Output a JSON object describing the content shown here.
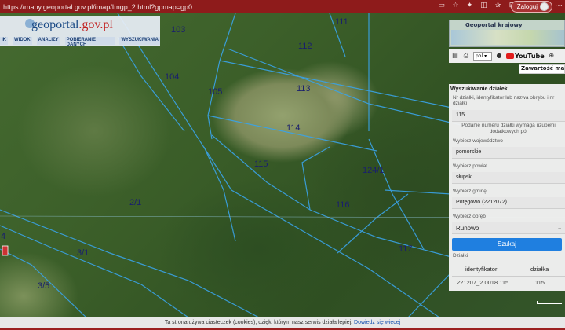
{
  "browser": {
    "url": "https://mapy.geoportal.gov.pl/imap/Imgp_2.html?gpmap=gp0",
    "login_label": "Zaloguj"
  },
  "logo": {
    "main": "geoportal",
    "suffix": ".gov.pl"
  },
  "topmenu": [
    "IK",
    "WIDOK",
    "ANALIZY",
    "POBIERANIE DANYCH",
    "WYSZUKIWANIA"
  ],
  "minimap": {
    "title": "Geoportal krajowy"
  },
  "toolbar": {
    "lang": "pol",
    "youtube": "YouTube",
    "contents_label": "Zawartość mapy"
  },
  "panel": {
    "title": "Wyszukiwanie działek",
    "parcel_label": "Nr działki, identyfikator lub nazwa obrębu i nr działki",
    "parcel_value": "115",
    "hint": "Podanie numeru działki wymaga uzupełni dodatkowych pól",
    "voiv_label": "Wybierz województwo",
    "voiv_value": "pomorskie",
    "county_label": "Wybierz powiat",
    "county_value": "słupski",
    "commune_label": "Wybierz gminę",
    "commune_value": "Potęgowo (2212072)",
    "precinct_label": "Wybierz obręb",
    "precinct_value": "Runowo",
    "search_button": "Szukaj",
    "results_label": "Działki",
    "table_headers": [
      "identyfikator",
      "działka"
    ],
    "table_rows": [
      [
        "221207_2.0018.115",
        "115"
      ]
    ]
  },
  "map": {
    "parcel_numbers": [
      "103",
      "111",
      "112",
      "104",
      "105",
      "113",
      "114",
      "115",
      "124/1",
      "116",
      "2/1",
      "3/1",
      "117",
      "3/5",
      "4"
    ]
  },
  "cookie": {
    "text": "Ta strona używa ciasteczek (cookies), dzięki którym nasz serwis działa lepiej.",
    "link": "Dowiedz się więcej"
  }
}
